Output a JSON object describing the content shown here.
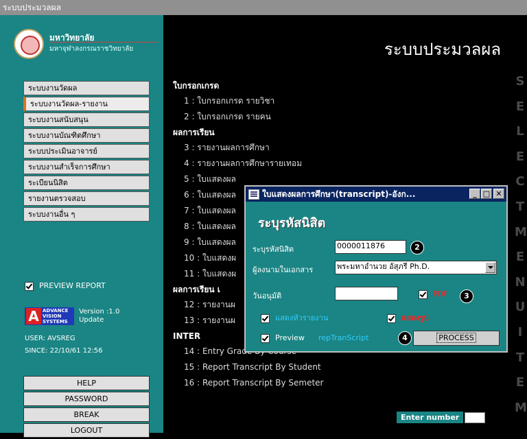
{
  "window_title": "ระบบประมวลผล",
  "logo": {
    "line1": "มหาวิทยาลัย",
    "line2": "มหาจุฬาลงกรณราชวิทยาลัย"
  },
  "main_title": "ระบบประมวลผล",
  "vertical_menu_text": [
    "S",
    "E",
    "L",
    "E",
    "C",
    "T",
    "M",
    "E",
    "N",
    "U",
    "I",
    "T",
    "E",
    "M"
  ],
  "sidebar_menu": [
    {
      "label": "ระบบงานวัดผล",
      "active": false
    },
    {
      "label": "ระบบงานวัดผล-รายงาน",
      "active": true
    },
    {
      "label": "ระบบงานสนับสนุน",
      "active": false
    },
    {
      "label": "ระบบงานบัณฑิตศึกษา",
      "active": false
    },
    {
      "label": "ระบบประเมินอาจารย์",
      "active": false
    },
    {
      "label": "ระบบงานสำเร็จการศึกษา",
      "active": false
    },
    {
      "label": "ระเบียนนิสิต",
      "active": false
    },
    {
      "label": "รายงานตรวจสอบ",
      "active": false
    },
    {
      "label": "ระบบงานอื่น ๆ",
      "active": false
    }
  ],
  "preview_report": {
    "label": "PREVIEW REPORT",
    "checked": true
  },
  "advance_logo": {
    "a": "A",
    "line1": "ADVANCE",
    "line2": "VISION",
    "line3": "SYSTEMS"
  },
  "version": {
    "line1": "Version :1.0",
    "line2": "Update"
  },
  "user": "USER: AVSREG",
  "since": "SINCE: 22/10/61 12:56",
  "buttons": {
    "help": "HELP",
    "password": "PASSWORD",
    "break": "BREAK",
    "logout": "LOGOUT"
  },
  "content": {
    "s1": "ใบกรอกเกรด",
    "i1": "1 : ใบกรอกเกรด รายวิชา",
    "i2": "2 : ใบกรอกเกรด รายคน",
    "s2": "ผลการเรียน",
    "i3": "3 : รายงานผลการศึกษา",
    "i4": "4 : รายงานผลการศึกษารายเทอม",
    "i5": "5 : ใบแสดงผล",
    "i6": "6 : ใบแสดงผล",
    "i7": "7 : ใบแสดงผล",
    "i8": "8 : ใบแสดงผล",
    "i9": "9 : ใบแสดงผล",
    "i10": "10 : ใบแสดงผ",
    "i11": "11 : ใบแสดงผ",
    "s3": "ผลการเรียน เ",
    "i12": "12 : รายงานผ",
    "i13": "13 : รายงานผ",
    "s4": "INTER",
    "i14": "14 : Entry Grade By Course",
    "i15": "15 : Report Transcript By Student",
    "i16": "16 : Report Transcript By Semeter"
  },
  "enter_number": "Enter number",
  "dialog": {
    "title": "ใบแสดงผลการศึกษา(transcript)-อังก...",
    "heading": "ระบุรหัสนิสิต",
    "student_id_label": "ระบุรหัสนิสิต",
    "student_id_value": "0000011876",
    "signer_label": "ผู้ลงนามในเอกสาร",
    "signer_value": "พระมหาอำนวย อัสุภรี Ph.D.",
    "approve_date_label": "วันอนุมัติ",
    "approve_date_value": "",
    "pdf_label": "PDF",
    "pdf_checked": true,
    "show_header_label": "แสดงหัวรายงาน",
    "show_header_checked": true,
    "show_photo_label": "แสดงรูป",
    "show_photo_checked": true,
    "preview_label": "Preview",
    "preview_checked": true,
    "report_name": "repTranScript",
    "process_label": "PROCESS",
    "badge2": "2",
    "badge3": "3",
    "badge4": "4"
  },
  "colors": {
    "sidebar": "#1a8584",
    "background": "#000000",
    "dialog_title": "#0a2460",
    "pdf": "#ff2020",
    "show_photo": "#ff2020",
    "link": "#33ccff"
  }
}
